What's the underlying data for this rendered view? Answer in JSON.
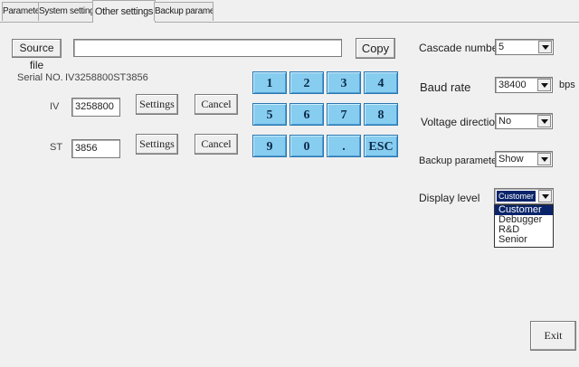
{
  "tabs": [
    "Parameters",
    "System settings",
    "Other settings",
    "Backup parameters"
  ],
  "source": {
    "button": "Source file",
    "path": "",
    "copy": "Copy"
  },
  "serial": {
    "label": "Serial NO.",
    "value": "IV3258800ST3856"
  },
  "iv": {
    "label": "IV",
    "value": "3258800",
    "settings": "Settings",
    "cancel": "Cancel"
  },
  "st": {
    "label": "ST",
    "value": "3856",
    "settings": "Settings",
    "cancel": "Cancel"
  },
  "keypad": [
    "1",
    "2",
    "3",
    "4",
    "5",
    "6",
    "7",
    "8",
    "9",
    "0",
    ".",
    "ESC"
  ],
  "right": {
    "cascade_label": "Cascade number",
    "cascade_value": "5",
    "baud_label": "Baud rate",
    "baud_value": "38400",
    "baud_unit": "bps",
    "voltage_label": "Voltage direction",
    "voltage_value": "No",
    "backup_label": "Backup parameters",
    "backup_value": "Show",
    "display_label": "Display level",
    "display_value": "Customer",
    "display_options": [
      "Customer",
      "Debugger",
      "R&D",
      "Senior"
    ]
  },
  "exit": "Exit",
  "colors": {
    "keypad": "#87cdf0",
    "selection": "#0a246a",
    "background": "#f0f0f0"
  }
}
